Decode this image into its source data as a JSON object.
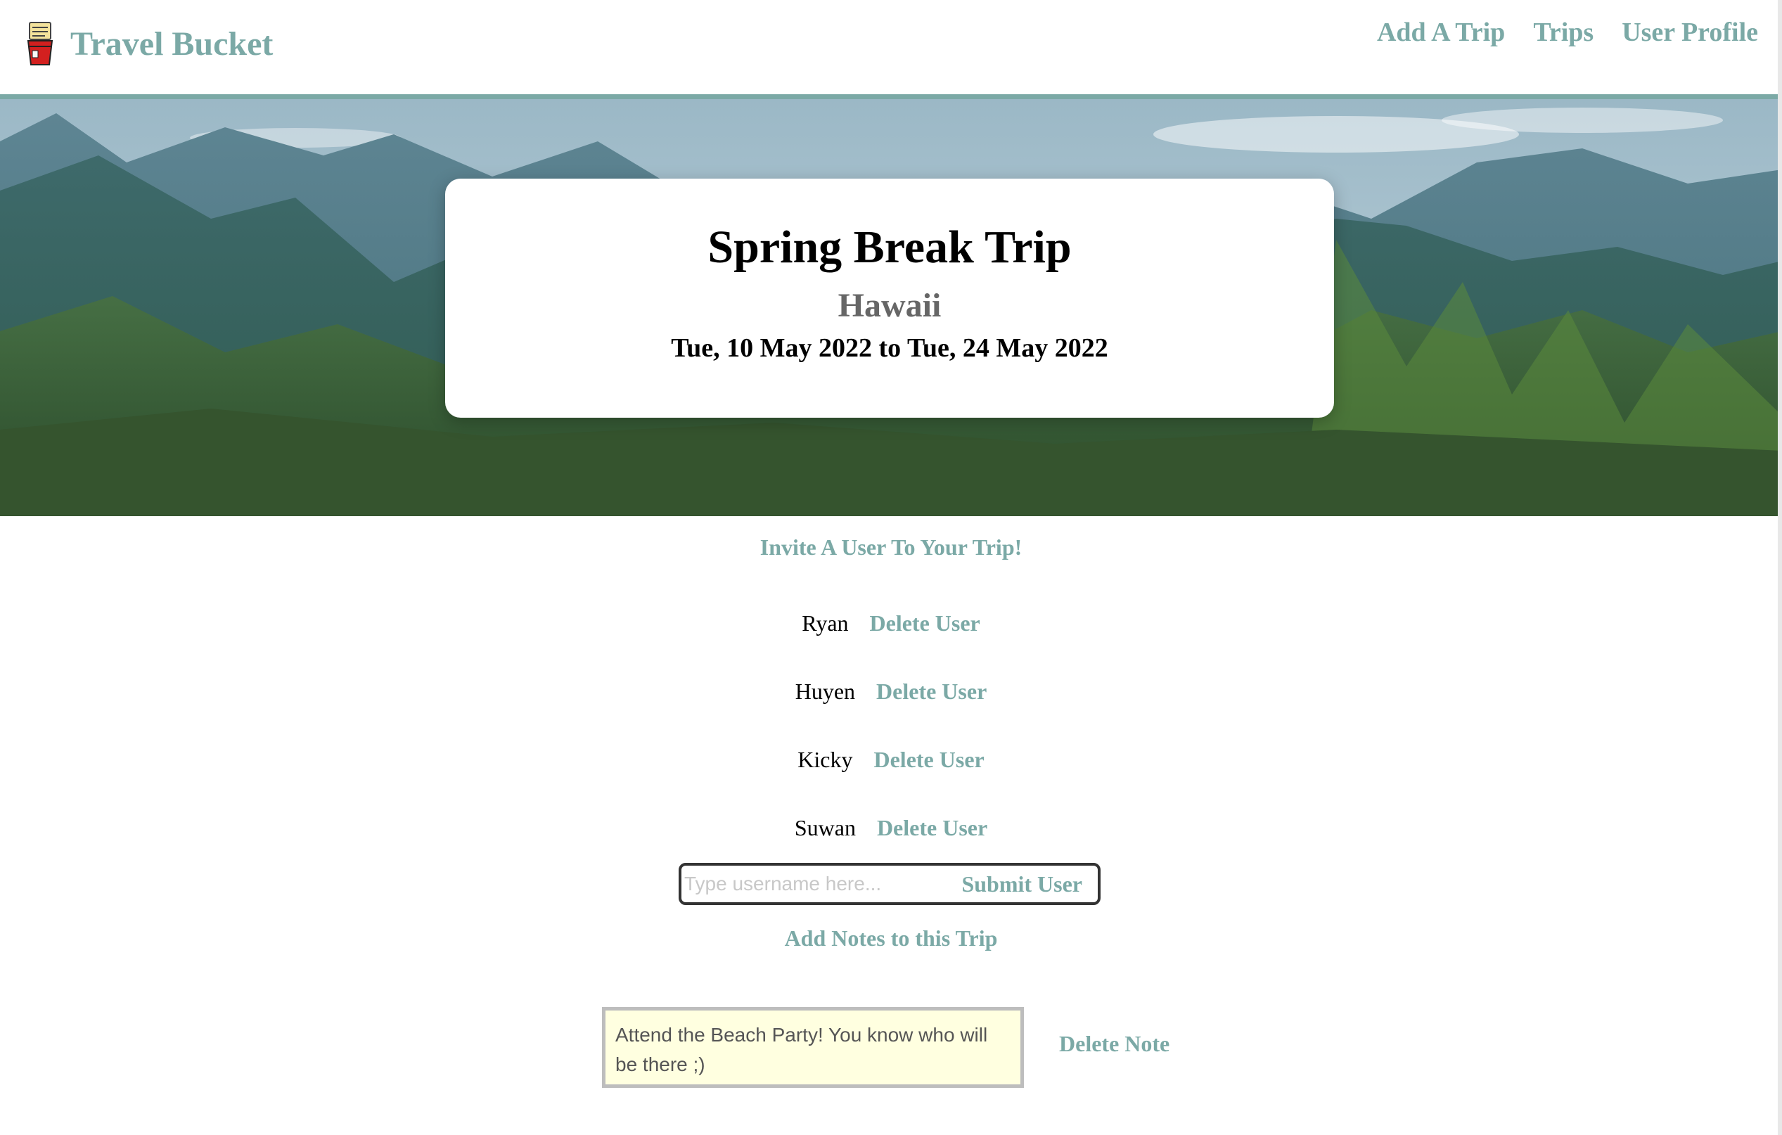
{
  "header": {
    "brand": "Travel Bucket",
    "nav": {
      "add_trip": "Add A Trip",
      "trips": "Trips",
      "user_profile": "User Profile"
    }
  },
  "trip": {
    "title": "Spring Break Trip",
    "location": "Hawaii",
    "dates": "Tue, 10 May 2022 to Tue, 24 May 2022"
  },
  "invite": {
    "heading": "Invite A User To Your Trip!",
    "delete_label": "Delete User",
    "users": [
      "Ryan",
      "Huyen",
      "Kicky",
      "Suwan"
    ],
    "input_placeholder": "Type username here...",
    "input_value": "",
    "submit_label": "Submit User"
  },
  "notes": {
    "heading": "Add Notes to this Trip",
    "items": [
      "Attend the Beach Party! You know who will be there ;)"
    ],
    "delete_label": "Delete Note"
  },
  "colors": {
    "accent": "#7ba9a6",
    "note_background": "#ffffe0"
  }
}
